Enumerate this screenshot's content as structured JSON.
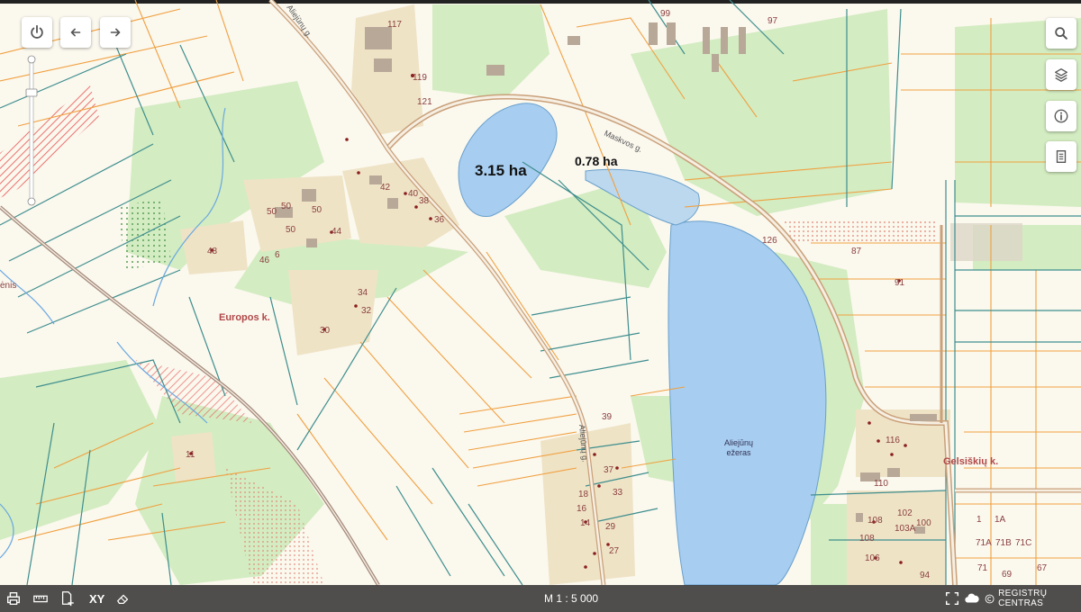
{
  "map": {
    "area_labels": [
      "3.15 ha",
      "0.78 ha"
    ],
    "localities": [
      "Europos k.",
      "Gelsiškių k."
    ],
    "roads": [
      "Aliejūnų g.",
      "Maskvos g.",
      "Aliejūnų g."
    ],
    "lake": [
      "Aliejūnų",
      "ežeras"
    ],
    "parcel_numbers": [
      "117",
      "119",
      "121",
      "99",
      "97",
      "42",
      "40",
      "38",
      "36",
      "50",
      "50",
      "50",
      "50",
      "44",
      "46",
      "6",
      "48",
      "34",
      "32",
      "30",
      "126",
      "87",
      "91",
      "39",
      "37",
      "18",
      "33",
      "16",
      "29",
      "14",
      "27",
      "116",
      "110",
      "102",
      "108",
      "103A",
      "100",
      "108",
      "106",
      "94",
      "1",
      "1A",
      "71A",
      "71B",
      "71C",
      "71",
      "69",
      "67",
      "11",
      "ėnis"
    ],
    "colors": {
      "water": "#a7cdf0",
      "green": "#d2ecc0",
      "parcel_orange": "#f0a040",
      "parcel_teal": "#3e8e8e",
      "road": "#c9a07a"
    }
  },
  "toolbar": {
    "icons": [
      "power-icon",
      "undo-icon",
      "redo-icon"
    ]
  },
  "right_panel": {
    "icons": [
      "search-icon",
      "layers-icon",
      "info-icon",
      "document-icon"
    ]
  },
  "bottombar": {
    "icons": [
      "print-icon",
      "measure-icon",
      "add-document-icon",
      "eraser-icon",
      "fullscreen-icon",
      "cloud-icon",
      "copyright-icon"
    ],
    "xy_label": "XY",
    "scale": "M 1 : 5 000",
    "copyright": "REGISTRŲ CENTRAS"
  }
}
